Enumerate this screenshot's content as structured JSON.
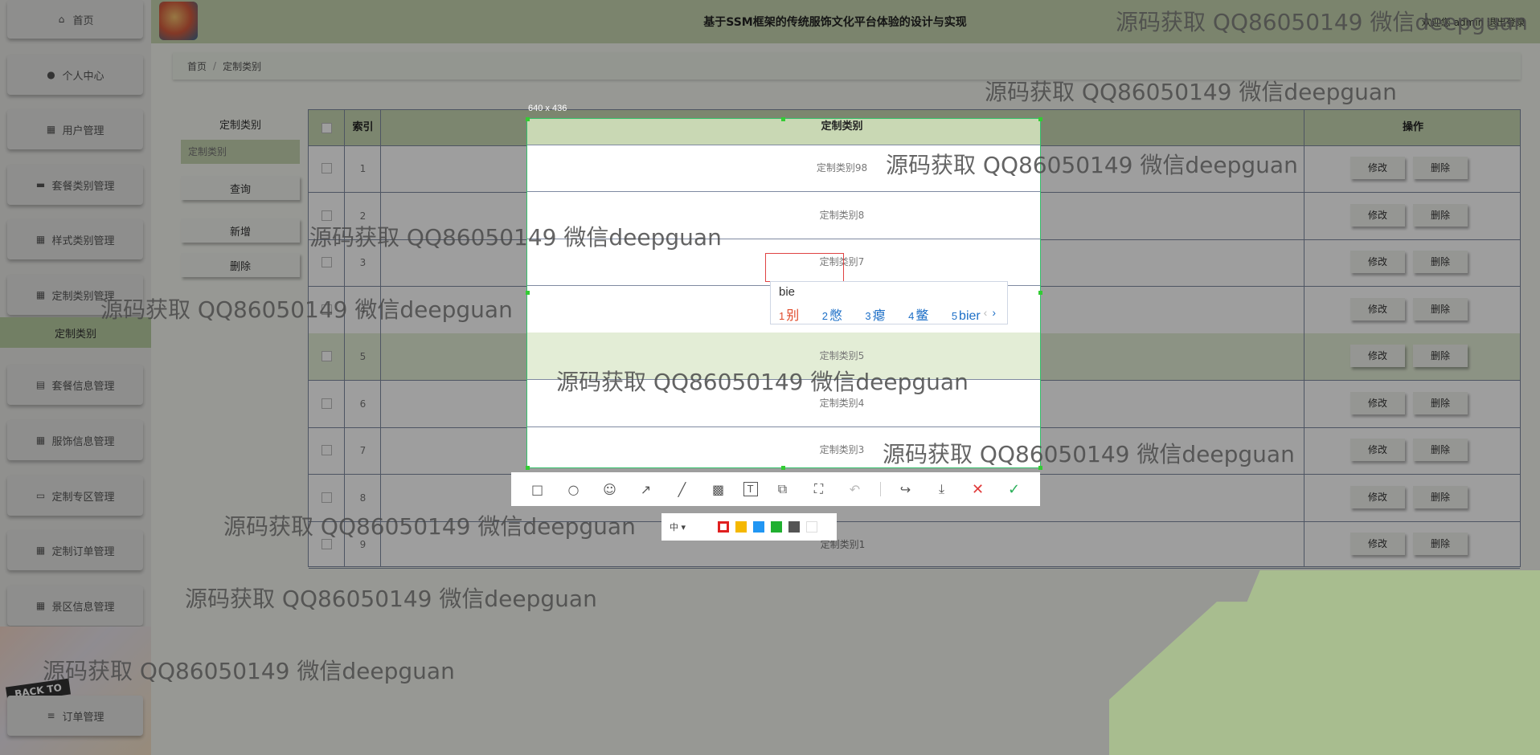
{
  "app": {
    "title": "基于SSM框架的传统服饰文化平台体验的设计与实现",
    "user": "欢迎您 admin  退出登录"
  },
  "sidebar": {
    "items": [
      {
        "label": "首页",
        "icon": "home-icon"
      },
      {
        "label": "个人中心",
        "icon": "user-icon"
      },
      {
        "label": "用户管理",
        "icon": "grid-icon"
      },
      {
        "label": "套餐类别管理",
        "icon": "briefcase-icon"
      },
      {
        "label": "样式类别管理",
        "icon": "grid-icon"
      },
      {
        "label": "定制类别管理",
        "icon": "grid-icon"
      },
      {
        "label": "套餐信息管理",
        "icon": "clipboard-icon"
      },
      {
        "label": "服饰信息管理",
        "icon": "grid-icon"
      },
      {
        "label": "定制专区管理",
        "icon": "monitor-icon"
      },
      {
        "label": "定制订单管理",
        "icon": "grid-icon"
      },
      {
        "label": "景区信息管理",
        "icon": "grid-icon"
      },
      {
        "label": "订单管理",
        "icon": "menu-icon"
      }
    ],
    "active_sub": "定制类别",
    "deco_tag": "BACK TO"
  },
  "breadcrumb": {
    "home": "首页",
    "sep": "/",
    "current": "定制类别"
  },
  "filter": {
    "label": "定制类别",
    "placeholder": "定制类别",
    "search_btn": "查询",
    "add_btn": "新增",
    "delete_btn": "删除"
  },
  "table": {
    "headers": {
      "index": "索引",
      "name": "定制类别",
      "ops": "操作"
    },
    "edit_label": "修改",
    "delete_label": "删除",
    "rows": [
      {
        "index": "1",
        "name": "定制类别98"
      },
      {
        "index": "2",
        "name": "定制类别8"
      },
      {
        "index": "3",
        "name": "定制类别7"
      },
      {
        "index": "4",
        "name": ""
      },
      {
        "index": "5",
        "name": "定制类别5"
      },
      {
        "index": "6",
        "name": "定制类别4"
      },
      {
        "index": "7",
        "name": "定制类别3"
      },
      {
        "index": "8",
        "name": ""
      },
      {
        "index": "9",
        "name": "定制类别1"
      }
    ]
  },
  "capture": {
    "size_label": "640 x 436",
    "tools": [
      "rect-icon",
      "ellipse-icon",
      "emoji-icon",
      "arrow-icon",
      "pen-icon",
      "mosaic-icon",
      "text-icon",
      "pin-icon",
      "ocr-icon",
      "undo-icon",
      "share-icon",
      "download-icon",
      "cancel-icon",
      "confirm-icon"
    ],
    "font_size_label": "中 ▾",
    "colors": [
      "#e02020",
      "#f5b800",
      "#2196f3",
      "#20b030",
      "#555555",
      "#ffffff"
    ],
    "selected_color": "#e02020"
  },
  "ime": {
    "input": "bie",
    "candidates": [
      {
        "num": "1",
        "text": "别"
      },
      {
        "num": "2",
        "text": "憋"
      },
      {
        "num": "3",
        "text": "瘪"
      },
      {
        "num": "4",
        "text": "鳖"
      },
      {
        "num": "5",
        "text": "bier"
      }
    ],
    "prev": "‹",
    "next": "›"
  },
  "watermark": "源码获取 QQ86050149 微信deepguan"
}
